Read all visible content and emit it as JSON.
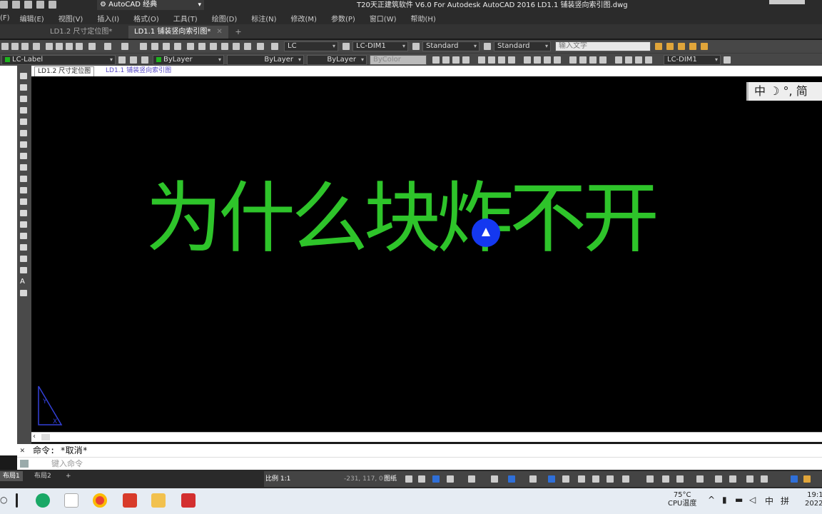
{
  "title_bar": {
    "workspace": "AutoCAD 经典",
    "window_title": "T20天正建筑软件 V6.0 For Autodesk AutoCAD 2016    LD1.1 铺装竖向索引图.dwg"
  },
  "menu": [
    "(F)",
    "编辑(E)",
    "视图(V)",
    "插入(I)",
    "格式(O)",
    "工具(T)",
    "绘图(D)",
    "标注(N)",
    "修改(M)",
    "参数(P)",
    "窗口(W)",
    "帮助(H)"
  ],
  "doc_tabs": [
    {
      "label": "LD1.2 尺寸定位图*",
      "active": false
    },
    {
      "label": "LD1.1 铺装竖向索引图*",
      "active": true
    }
  ],
  "toolbar1": {
    "text_style": "LC",
    "dim_style": "LC-DIM1",
    "table_style": "Standard",
    "multileader_style": "Standard",
    "search_placeholder": "输入文字"
  },
  "toolbar2": {
    "layer": "LC-Label",
    "color": "ByLayer",
    "linetype": "ByLayer",
    "lineweight": "ByLayer",
    "plot_style": "ByColor",
    "dim_style2": "LC-DIM1"
  },
  "file_tabs": [
    "LD1.2 尺寸定位图",
    "LD1.1 铺装竖向索引图"
  ],
  "canvas": {
    "headline": "为什么块炸不开",
    "text_color": "#2ec42a",
    "background": "#000000",
    "ime_bar": "中 ☽ °, 简"
  },
  "command": {
    "history": "命令: *取消*",
    "placeholder": "键入命令"
  },
  "layout_tabs": [
    "布局1",
    "布局2"
  ],
  "status": {
    "scale": "比例 1:1",
    "coords": "-231, 117, 0",
    "paper": "图纸"
  },
  "taskbar": {
    "temperature": "75°C",
    "temp_label": "CPU温度",
    "ime_mode": "中",
    "ime_extra": "拼",
    "time": "19:1",
    "date": "2022/"
  }
}
